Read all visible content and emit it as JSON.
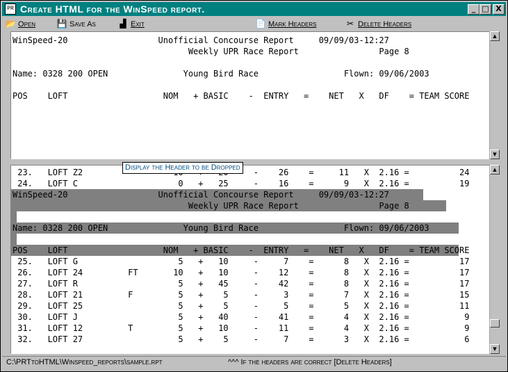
{
  "window": {
    "title": "Create HTML for the WinSpeed report.",
    "app_icon": "prt-app-icon",
    "minimize": "_",
    "maximize": "□",
    "close": "X"
  },
  "menu": [
    {
      "label": "Open",
      "icon": "folder-open-icon",
      "glyph": "📂"
    },
    {
      "label": "Save As",
      "icon": "floppy-disk-icon",
      "glyph": "💾"
    },
    {
      "label": "Exit",
      "icon": "door-exit-icon",
      "glyph": "▟"
    },
    {
      "label": "Mark Headers",
      "icon": "mark-document-icon",
      "glyph": "📄"
    },
    {
      "label": "Delete Headers",
      "icon": "scissors-icon",
      "glyph": "✂"
    }
  ],
  "top_pane": {
    "lines": [
      "WinSpeed-20                  Unofficial Concourse Report     09/09/03-12:27",
      "                                   Weekly UPR Race Report                Page 8",
      "",
      "Name: 0328 200 OPEN               Young Bird Race                 Flown: 09/06/2003",
      "",
      "POS    LOFT                   NOM   + BASIC    -  ENTRY   =    NET   X   DF    = TEAM SCORE"
    ]
  },
  "bottom_pane": {
    "rows_before": [
      " 23.   LOFT Z2                  10   +   20     -    26    =     11   X  2.16 =          24",
      " 24.   LOFT C                    0   +   25     -    16    =      9   X  2.16 =          19"
    ],
    "header_lines": [
      "WinSpeed-20                  Unofficial Concourse Report     09/09/03-12:27",
      "                                   Weekly UPR Race Report                Page 8",
      "",
      "Name: 0328 200 OPEN               Young Bird Race                 Flown: 09/06/2003",
      "",
      "POS    LOFT                   NOM   + BASIC    -  ENTRY   =    NET   X   DF    = TEAM SCORE"
    ],
    "rows_after": [
      " 25.   LOFT G                    5   +   10     -     7    =      8   X  2.16 =          17",
      " 26.   LOFT 24         FT       10   +   10     -    12    =      8   X  2.16 =          17",
      " 27.   LOFT R                    5   +   45     -    42    =      8   X  2.16 =          17",
      " 28.   LOFT 21         F         5   +    5     -     3    =      7   X  2.16 =          15",
      " 29.   LOFT 25                   5   +    5     -     5    =      5   X  2.16 =          11",
      " 30.   LOFT J                    5   +   40     -    41    =      4   X  2.16 =           9",
      " 31.   LOFT 12         T         5   +   10     -    11    =      4   X  2.16 =           9",
      " 32.   LOFT 27                   5   +    5     -     7    =      3   X  2.16 =           6"
    ]
  },
  "tooltip": "Display the Header to be Dropped",
  "status": {
    "path": "C:\\PRTtoHTML\\Winspeed_reports\\sample.rpt",
    "message": "^^^ If the headers are correct [Delete Headers]"
  }
}
